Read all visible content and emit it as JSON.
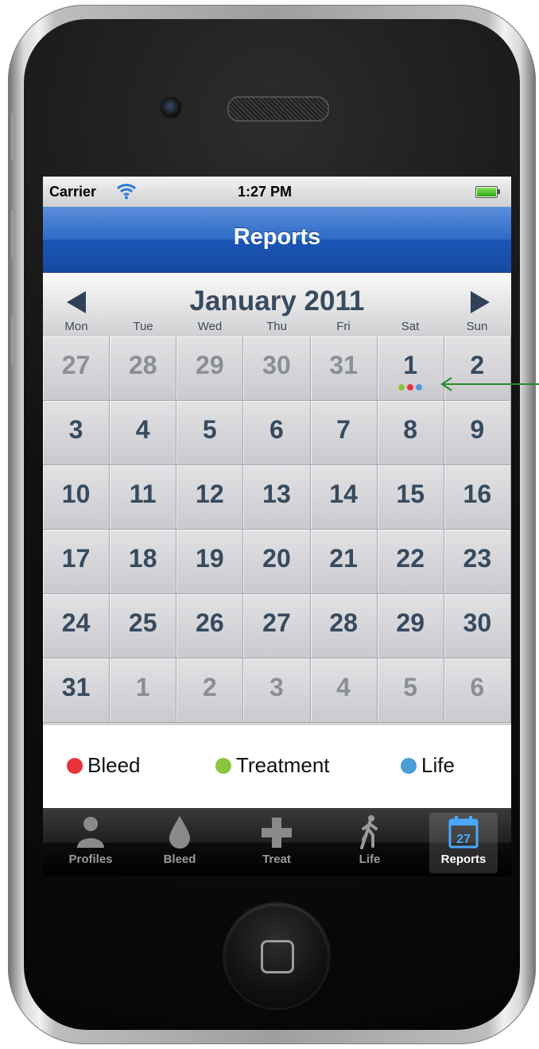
{
  "statusbar": {
    "carrier": "Carrier",
    "time": "1:27 PM"
  },
  "navbar": {
    "title": "Reports"
  },
  "calendar": {
    "month_title": "January 2011",
    "weekdays": [
      "Mon",
      "Tue",
      "Wed",
      "Thu",
      "Fri",
      "Sat",
      "Sun"
    ],
    "weeks": [
      [
        {
          "d": "27",
          "o": true
        },
        {
          "d": "28",
          "o": true
        },
        {
          "d": "29",
          "o": true
        },
        {
          "d": "30",
          "o": true
        },
        {
          "d": "31",
          "o": true
        },
        {
          "d": "1",
          "o": false,
          "dots": [
            "#8bc53f",
            "#e8333b",
            "#4a9ed8"
          ]
        },
        {
          "d": "2",
          "o": false
        }
      ],
      [
        {
          "d": "3"
        },
        {
          "d": "4"
        },
        {
          "d": "5"
        },
        {
          "d": "6"
        },
        {
          "d": "7"
        },
        {
          "d": "8"
        },
        {
          "d": "9"
        }
      ],
      [
        {
          "d": "10"
        },
        {
          "d": "11"
        },
        {
          "d": "12"
        },
        {
          "d": "13"
        },
        {
          "d": "14"
        },
        {
          "d": "15"
        },
        {
          "d": "16"
        }
      ],
      [
        {
          "d": "17"
        },
        {
          "d": "18"
        },
        {
          "d": "19"
        },
        {
          "d": "20"
        },
        {
          "d": "21"
        },
        {
          "d": "22"
        },
        {
          "d": "23"
        }
      ],
      [
        {
          "d": "24"
        },
        {
          "d": "25"
        },
        {
          "d": "26"
        },
        {
          "d": "27"
        },
        {
          "d": "28"
        },
        {
          "d": "29"
        },
        {
          "d": "30"
        }
      ],
      [
        {
          "d": "31"
        },
        {
          "d": "1",
          "o": true
        },
        {
          "d": "2",
          "o": true
        },
        {
          "d": "3",
          "o": true
        },
        {
          "d": "4",
          "o": true
        },
        {
          "d": "5",
          "o": true
        },
        {
          "d": "6",
          "o": true
        }
      ]
    ]
  },
  "legend": [
    {
      "label": "Bleed",
      "color": "#e8333b"
    },
    {
      "label": "Treatment",
      "color": "#8bc53f"
    },
    {
      "label": "Life",
      "color": "#4a9ed8"
    }
  ],
  "tabbar": {
    "tabs": [
      {
        "label": "Profiles",
        "icon": "person-icon"
      },
      {
        "label": "Bleed",
        "icon": "drop-icon"
      },
      {
        "label": "Treat",
        "icon": "cross-icon"
      },
      {
        "label": "Life",
        "icon": "walking-person-icon"
      },
      {
        "label": "Reports",
        "icon": "calendar-icon",
        "active": true
      }
    ],
    "reports_icon_day": "27"
  }
}
